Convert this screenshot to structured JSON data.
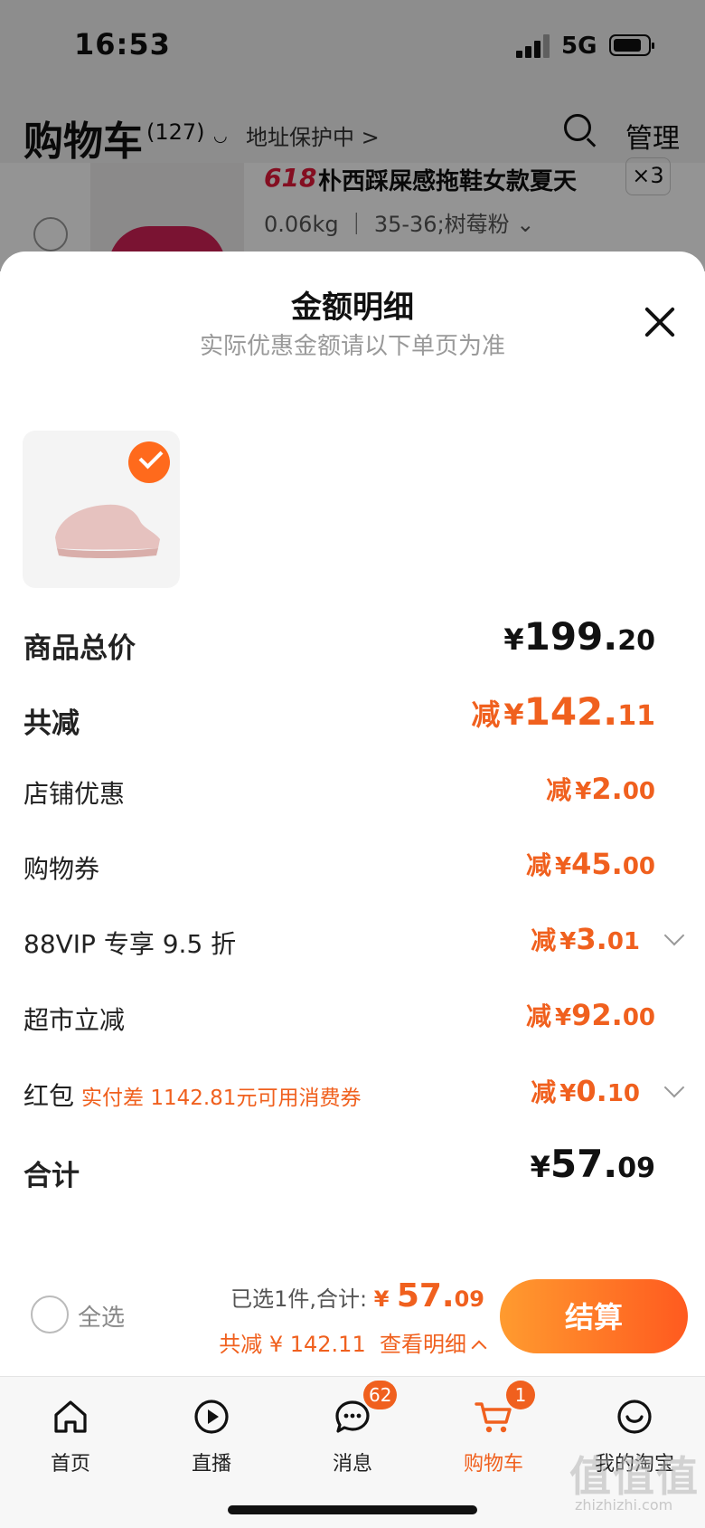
{
  "status": {
    "time": "16:53",
    "network": "5G"
  },
  "cart": {
    "title": "购物车",
    "count": "(127)",
    "address": "地址保护中 >",
    "manage": "管理",
    "item": {
      "tag": "618",
      "name": "朴西踩屎感拖鞋女款夏天",
      "qty": "×3",
      "spec": "0.06kg ｜ 35-36;树莓粉 ⌄"
    }
  },
  "sheet": {
    "title": "金额明细",
    "subtitle": "实际优惠金额请以下单页为准",
    "rows": {
      "total": {
        "label": "商品总价",
        "yen": "¥",
        "int": "199.",
        "dec": "20"
      },
      "saved": {
        "label": "共减",
        "pre": "减",
        "yen": "¥",
        "int": "142.",
        "dec": "11"
      },
      "shop": {
        "label": "店铺优惠",
        "pre": "减",
        "yen": "¥",
        "int": "2.",
        "dec": "00"
      },
      "coupon": {
        "label": "购物券",
        "pre": "减",
        "yen": "¥",
        "int": "45.",
        "dec": "00"
      },
      "vip": {
        "label": "88VIP 专享 9.5 折",
        "pre": "减",
        "yen": "¥",
        "int": "3.",
        "dec": "01"
      },
      "market": {
        "label": "超市立减",
        "pre": "减",
        "yen": "¥",
        "int": "92.",
        "dec": "00"
      },
      "hongbao": {
        "label": "红包",
        "note": "实付差 1142.81元可用消费券",
        "pre": "减",
        "yen": "¥",
        "int": "0.",
        "dec": "10"
      },
      "sum": {
        "label": "合计",
        "yen": "¥",
        "int": "57.",
        "dec": "09"
      }
    }
  },
  "checkout": {
    "select_all": "全选",
    "selected": "已选1件,合计: ",
    "yen": "¥ ",
    "int": "57.",
    "dec": "09",
    "reduced": "共减 ¥ 142.11",
    "details": "查看明细",
    "pay": "结算"
  },
  "tabs": [
    {
      "label": "首页"
    },
    {
      "label": "直播"
    },
    {
      "label": "消息",
      "badge": "62"
    },
    {
      "label": "购物车",
      "badge": "1"
    },
    {
      "label": "我的淘宝"
    }
  ],
  "watermark": {
    "text": "值值值",
    "url": "zhizhizhi.com"
  },
  "colors": {
    "accent": "#f0601e",
    "badge_check": "#ff6a1c"
  }
}
